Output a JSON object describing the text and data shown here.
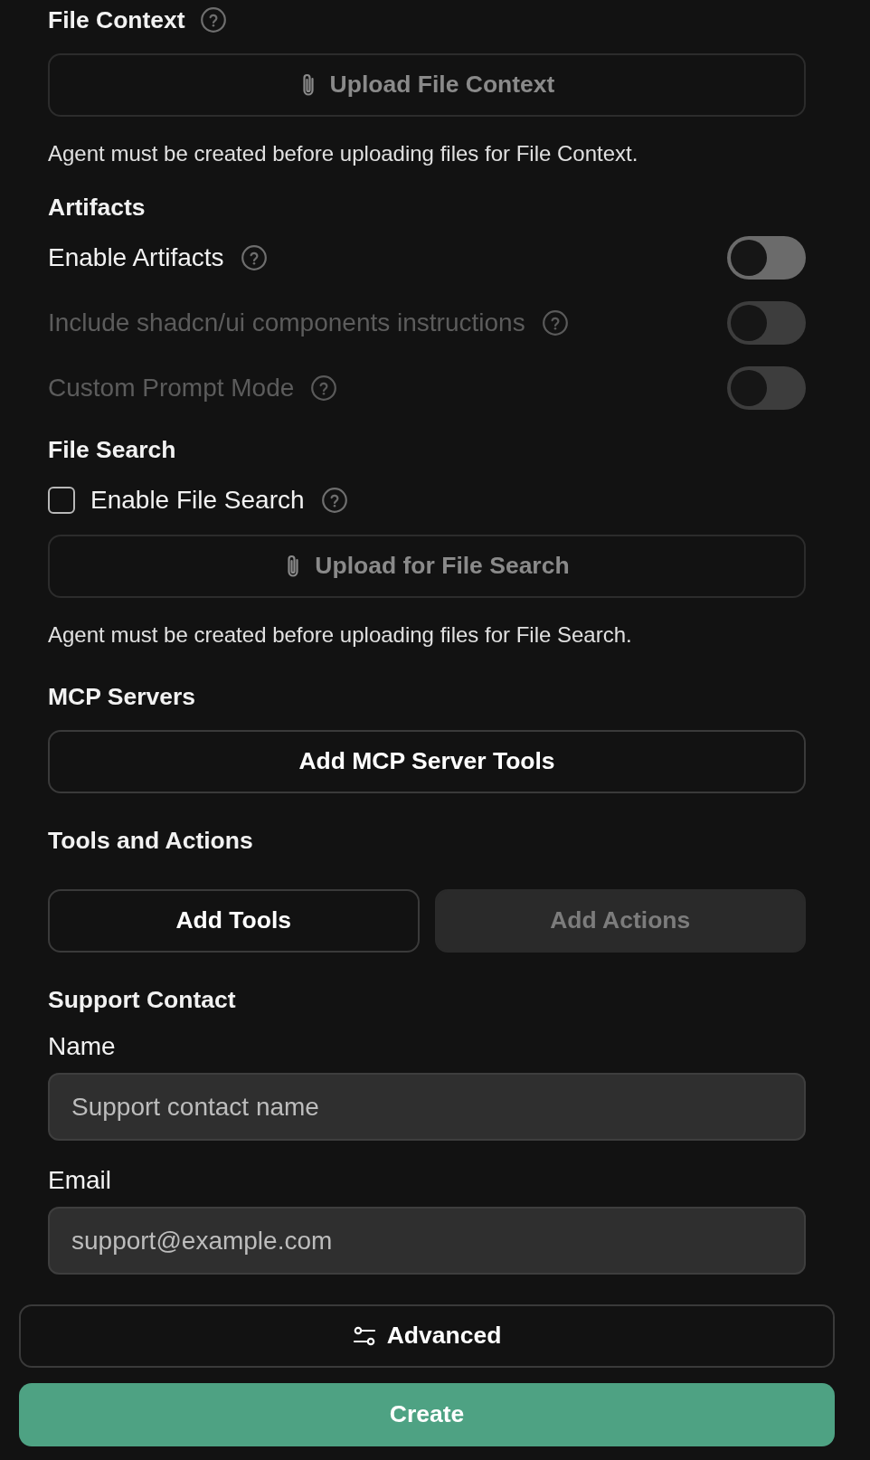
{
  "file_context": {
    "title": "File Context",
    "help": true,
    "upload_button": {
      "label": "Upload File Context",
      "disabled": true
    },
    "note": "Agent must be created before uploading files for File Context."
  },
  "artifacts": {
    "title": "Artifacts",
    "options": [
      {
        "label": "Enable Artifacts",
        "help": true,
        "on": false,
        "disabled": false
      },
      {
        "label": "Include shadcn/ui components instructions",
        "help": true,
        "on": false,
        "disabled": true
      },
      {
        "label": "Custom Prompt Mode",
        "help": true,
        "on": false,
        "disabled": true
      }
    ]
  },
  "file_search": {
    "title": "File Search",
    "checkbox": {
      "label": "Enable File Search",
      "help": true,
      "checked": false
    },
    "upload_button": {
      "label": "Upload for File Search",
      "disabled": true
    },
    "note": "Agent must be created before uploading files for File Search."
  },
  "mcp_servers": {
    "title": "MCP Servers",
    "button": {
      "label": "Add MCP Server Tools",
      "disabled": false
    }
  },
  "tools_and_actions": {
    "title": "Tools and Actions",
    "buttons": [
      {
        "label": "Add Tools",
        "disabled": false
      },
      {
        "label": "Add Actions",
        "disabled": true
      }
    ]
  },
  "support_contact": {
    "title": "Support Contact",
    "fields": [
      {
        "label": "Name",
        "placeholder": "Support contact name"
      },
      {
        "label": "Email",
        "placeholder": "support@example.com"
      }
    ]
  },
  "advanced_button": {
    "label": "Advanced"
  },
  "create_button": {
    "label": "Create"
  }
}
